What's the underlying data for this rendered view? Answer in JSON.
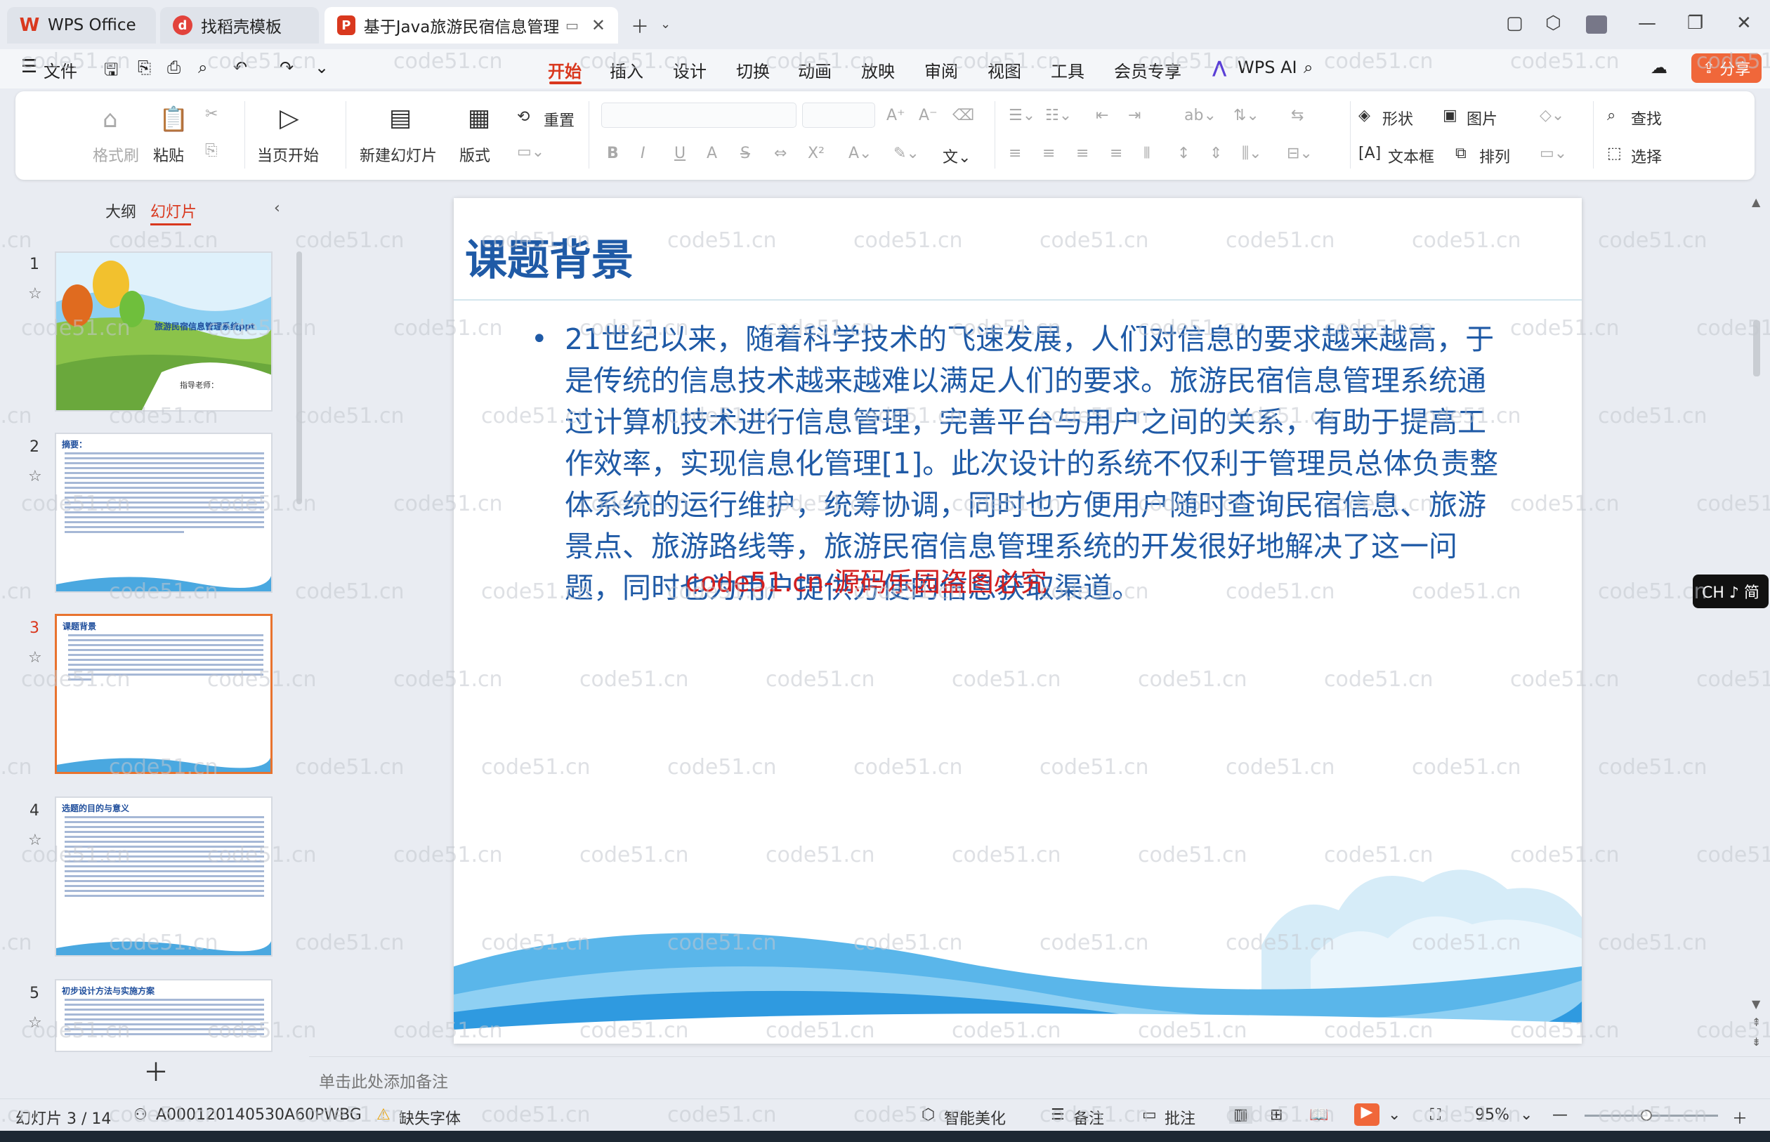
{
  "tabs": [
    {
      "label": "WPS Office",
      "icon": "wps-logo-icon"
    },
    {
      "label": "找稻壳模板",
      "icon": "docer-icon"
    },
    {
      "label": "基于Java旅游民宿信息管理系",
      "icon": "ppt-icon"
    }
  ],
  "menu": {
    "file": "文件",
    "items": [
      "开始",
      "插入",
      "设计",
      "切换",
      "动画",
      "放映",
      "审阅",
      "视图",
      "工具",
      "会员专享"
    ],
    "active": "开始",
    "wps_ai": "WPS AI",
    "share": "分享"
  },
  "ribbon": {
    "format_painter": "格式刷",
    "paste": "粘贴",
    "play_from_current": "当页开始",
    "new_slide": "新建幻灯片",
    "layout": "版式",
    "reset": "重置",
    "shape": "形状",
    "picture": "图片",
    "find": "查找",
    "textbox": "文本框",
    "arrange": "排列",
    "select": "选择"
  },
  "left_panel": {
    "tab_outline": "大纲",
    "tab_slides": "幻灯片",
    "thumbnails": [
      {
        "num": "1",
        "title": "旅游民宿信息管理系统ppt",
        "subtitle": "指导老师："
      },
      {
        "num": "2",
        "title": "摘要："
      },
      {
        "num": "3",
        "title": "课题背景"
      },
      {
        "num": "4",
        "title": "选题的目的与意义"
      },
      {
        "num": "5",
        "title": "初步设计方法与实施方案"
      }
    ]
  },
  "slide": {
    "title": "课题背景",
    "bullet": "•",
    "body": "21世纪以来，随着科学技术的飞速发展，人们对信息的要求越来越高，于是传统的信息技术越来越难以满足人们的要求。旅游民宿信息管理系统通过计算机技术进行信息管理，完善平台与用户之间的关系，有助于提高工作效率，实现信息化管理[1]。此次设计的系统不仅利于管理员总体负责整体系统的运行维护，统筹协调，同时也方便用户随时查询民宿信息、旅游景点、旅游路线等，旅游民宿信息管理系统的开发很好地解决了这一问题，同时也为用户提供方便的信息获取渠道。",
    "overlay": "code51.cn-源码乐园盗图必究"
  },
  "notes_placeholder": "单击此处添加备注",
  "status": {
    "slide_count": "幻灯片 3 / 14",
    "doc_id": "A000120140530A60PWBG",
    "missing_font": "缺失字体",
    "beautify": "智能美化",
    "notes": "备注",
    "comment": "批注",
    "zoom": "95%"
  },
  "ime": "CH ♪ 简",
  "watermark": "code51.cn",
  "colors": {
    "accent": "#d9381e",
    "slide_text": "#1f5aa6",
    "share": "#f0673a"
  }
}
